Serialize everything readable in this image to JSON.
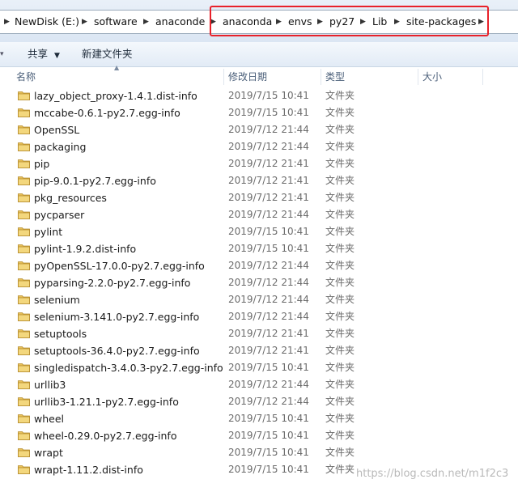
{
  "breadcrumb": {
    "items": [
      "NewDisk (E:)",
      "software",
      "anaconde",
      "anaconda",
      "envs",
      "py27",
      "Lib",
      "site-packages"
    ]
  },
  "toolbar": {
    "share_label": "共享",
    "new_folder_label": "新建文件夹"
  },
  "columns": {
    "name": "名称",
    "date": "修改日期",
    "type": "类型",
    "size": "大小"
  },
  "files": [
    {
      "name": "lazy_object_proxy-1.4.1.dist-info",
      "date": "2019/7/15 10:41",
      "type": "文件夹"
    },
    {
      "name": "mccabe-0.6.1-py2.7.egg-info",
      "date": "2019/7/15 10:41",
      "type": "文件夹"
    },
    {
      "name": "OpenSSL",
      "date": "2019/7/12 21:44",
      "type": "文件夹"
    },
    {
      "name": "packaging",
      "date": "2019/7/12 21:44",
      "type": "文件夹"
    },
    {
      "name": "pip",
      "date": "2019/7/12 21:41",
      "type": "文件夹"
    },
    {
      "name": "pip-9.0.1-py2.7.egg-info",
      "date": "2019/7/12 21:41",
      "type": "文件夹"
    },
    {
      "name": "pkg_resources",
      "date": "2019/7/12 21:41",
      "type": "文件夹"
    },
    {
      "name": "pycparser",
      "date": "2019/7/12 21:44",
      "type": "文件夹"
    },
    {
      "name": "pylint",
      "date": "2019/7/15 10:41",
      "type": "文件夹"
    },
    {
      "name": "pylint-1.9.2.dist-info",
      "date": "2019/7/15 10:41",
      "type": "文件夹"
    },
    {
      "name": "pyOpenSSL-17.0.0-py2.7.egg-info",
      "date": "2019/7/12 21:44",
      "type": "文件夹"
    },
    {
      "name": "pyparsing-2.2.0-py2.7.egg-info",
      "date": "2019/7/12 21:44",
      "type": "文件夹"
    },
    {
      "name": "selenium",
      "date": "2019/7/12 21:44",
      "type": "文件夹"
    },
    {
      "name": "selenium-3.141.0-py2.7.egg-info",
      "date": "2019/7/12 21:44",
      "type": "文件夹"
    },
    {
      "name": "setuptools",
      "date": "2019/7/12 21:41",
      "type": "文件夹"
    },
    {
      "name": "setuptools-36.4.0-py2.7.egg-info",
      "date": "2019/7/12 21:41",
      "type": "文件夹"
    },
    {
      "name": "singledispatch-3.4.0.3-py2.7.egg-info",
      "date": "2019/7/15 10:41",
      "type": "文件夹"
    },
    {
      "name": "urllib3",
      "date": "2019/7/12 21:44",
      "type": "文件夹"
    },
    {
      "name": "urllib3-1.21.1-py2.7.egg-info",
      "date": "2019/7/12 21:44",
      "type": "文件夹"
    },
    {
      "name": "wheel",
      "date": "2019/7/15 10:41",
      "type": "文件夹"
    },
    {
      "name": "wheel-0.29.0-py2.7.egg-info",
      "date": "2019/7/15 10:41",
      "type": "文件夹"
    },
    {
      "name": "wrapt",
      "date": "2019/7/15 10:41",
      "type": "文件夹"
    },
    {
      "name": "wrapt-1.11.2.dist-info",
      "date": "2019/7/15 10:41",
      "type": "文件夹"
    }
  ],
  "watermark": "https://blog.csdn.net/m1f2c3",
  "colors": {
    "highlight": "#e8212a",
    "folder": "#e8c15a"
  },
  "icons": {
    "folder": "folder-icon",
    "chevron": "chevron-right-icon",
    "dropdown": "dropdown-arrow-icon",
    "sort": "sort-ascending-icon"
  }
}
